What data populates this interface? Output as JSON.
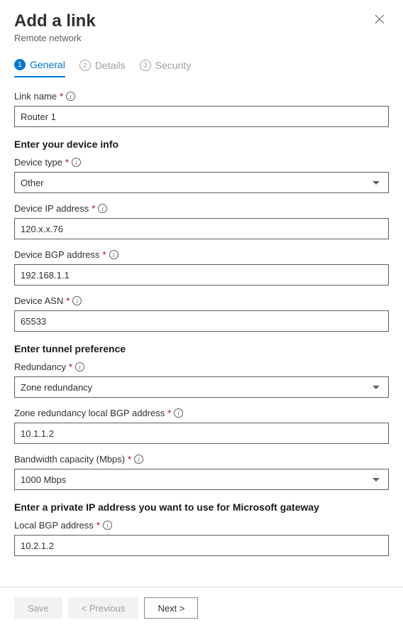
{
  "header": {
    "title": "Add a link",
    "subtitle": "Remote network"
  },
  "tabs": [
    {
      "num": "1",
      "label": "General",
      "active": true
    },
    {
      "num": "2",
      "label": "Details",
      "active": false
    },
    {
      "num": "3",
      "label": "Security",
      "active": false
    }
  ],
  "sections": {
    "device_info": "Enter your device info",
    "tunnel_pref": "Enter tunnel preference",
    "private_ip": "Enter a private IP address you want to use for Microsoft gateway"
  },
  "fields": {
    "link_name": {
      "label": "Link name",
      "value": "Router 1"
    },
    "device_type": {
      "label": "Device type",
      "value": "Other"
    },
    "device_ip": {
      "label": "Device IP address",
      "value": "120.x.x.76"
    },
    "device_bgp": {
      "label": "Device BGP address",
      "value": "192.168.1.1"
    },
    "device_asn": {
      "label": "Device ASN",
      "value": "65533"
    },
    "redundancy": {
      "label": "Redundancy",
      "value": "Zone redundancy"
    },
    "zone_bgp": {
      "label": "Zone redundancy local BGP address",
      "value": "10.1.1.2"
    },
    "bandwidth": {
      "label": "Bandwidth capacity (Mbps)",
      "value": "1000 Mbps"
    },
    "local_bgp": {
      "label": "Local BGP address",
      "value": "10.2.1.2"
    }
  },
  "footer": {
    "save": "Save",
    "previous": "< Previous",
    "next": "Next >"
  },
  "required_marker": "*",
  "info_marker": "i"
}
